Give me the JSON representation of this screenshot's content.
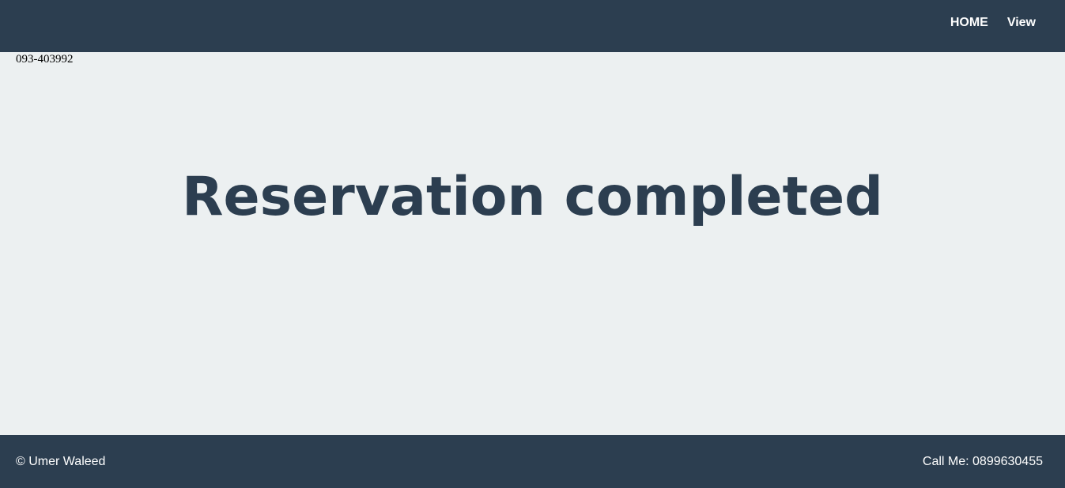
{
  "header": {
    "nav": [
      {
        "label": "HOME"
      },
      {
        "label": "View"
      }
    ]
  },
  "main": {
    "phone": "093-403992",
    "title": "Reservation completed"
  },
  "footer": {
    "copyright": "© Umer Waleed",
    "contact": "Call Me: 0899630455"
  },
  "colors": {
    "header_bg": "#2c3e50",
    "page_bg": "#ecf0f1",
    "title": "#2c3e50",
    "nav_text": "#ffffff"
  }
}
